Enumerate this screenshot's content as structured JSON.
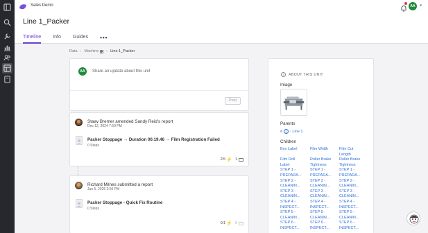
{
  "brand": {
    "name": "Sales Demo",
    "color": "#7b4fe0"
  },
  "user": {
    "initials": "AA",
    "avatar_color": "#1f8a3c"
  },
  "page": {
    "title": "Line 1_Packer"
  },
  "tabs": [
    {
      "label": "Timeline",
      "active": true
    },
    {
      "label": "Info",
      "active": false
    },
    {
      "label": "Guides",
      "active": false
    }
  ],
  "breadcrumb": {
    "items": [
      "Data",
      "Machine",
      "Line 1_Packer"
    ]
  },
  "composer": {
    "avatar_initials": "AA",
    "placeholder": "Share an update about this unit",
    "post_label": "Post"
  },
  "feed": [
    {
      "actor": "Staav Bremer amended Sandy Reid's report",
      "date": "Dec 12, 2024 7:50 PM",
      "title": "Packer Stoppage → Duration 00.19.46 → Film Registration Failed",
      "steps": "0 Steps",
      "score": "2/5",
      "comments": "1"
    },
    {
      "actor": "Richard Milnes submitted a report",
      "date": "Jun 5, 2025 2:56 PM",
      "title": "Packer Stoppage - Quick Fix Routine",
      "steps": "0 Steps",
      "score": "0/1",
      "comments": "0"
    }
  ],
  "about": {
    "heading": "ABOUT THIS UNIT",
    "image_label": "Image",
    "parents_label": "Parents",
    "parent": {
      "prefix": "#",
      "count": "1",
      "name": "- Line 1"
    },
    "children_label": "Children",
    "children_columns": [
      [
        "Box Label",
        "",
        "Film Roll",
        "Label",
        "STEP 1 -",
        "PREPARA...",
        "STEP 2 -",
        "CLEANIN...",
        "STEP 3 -",
        "CLEANIN...",
        "STEP 4 -",
        "INSPECT...",
        "STEP 5 -",
        "CLEANIN...",
        "STEP 6 -",
        "INSPECT..."
      ],
      [
        "Film Width",
        "",
        "Roller Brake",
        "Tightness",
        "STEP 1 -",
        "PREPARA...",
        "STEP 2 -",
        "CLEANIN...",
        "STEP 3 -",
        "CLEANIN...",
        "STEP 4 -",
        "INSPECT...",
        "STEP 5 -",
        "CLEANIN...",
        "STEP 6 -",
        "INSPECT..."
      ],
      [
        "Film Cut",
        "Length",
        "Roller Brake",
        "Tightness",
        "STEP 1 -",
        "PREPARA...",
        "STEP 2 -",
        "CLEANIN...",
        "STEP 3 -",
        "CLEANIN...",
        "STEP 4 -",
        "INSPECT...",
        "STEP 5 -",
        "CLEANIN...",
        "STEP 6 -",
        "INSPECT..."
      ]
    ]
  },
  "colors": {
    "accent": "#6a3ed2",
    "link": "#2f6fd6",
    "rail": "#27282d",
    "bolt": "#f0b400"
  }
}
